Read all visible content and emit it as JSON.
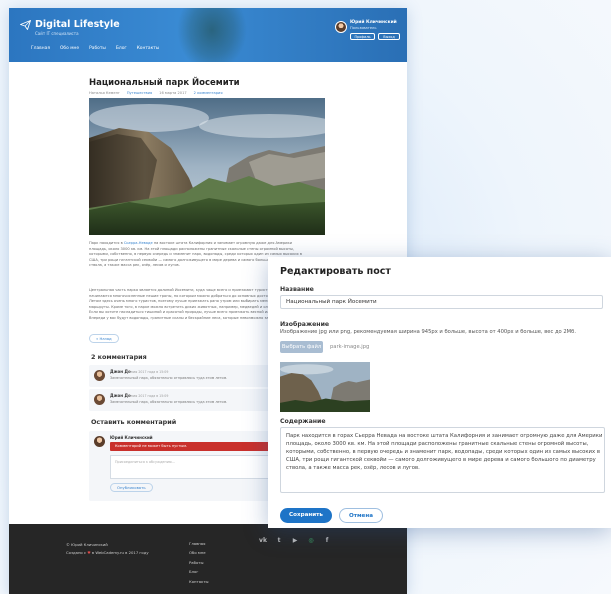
{
  "colors": {
    "header_blue": "#2c76c0",
    "accent": "#1e74c7",
    "error_red": "#c9302c",
    "footer_dark": "#262626"
  },
  "header": {
    "logo_icon": "paper-plane-icon",
    "title": "Digital Lifestyle",
    "subtitle": "Сайт IT специалиста",
    "nav": [
      "Главная",
      "Обо мне",
      "Работы",
      "Блог",
      "Контакты"
    ],
    "user_name": "Юрий Кличинский",
    "user_role": "Пользователь",
    "profile_button": "Профиль",
    "logout_button": "Выход"
  },
  "post": {
    "title": "Национальный парк Йосемити",
    "author": "Наталья Кеменг",
    "category": "Путешествия",
    "date": "16 марта 2017",
    "comments_link": "2 комментария",
    "paragraph1": [
      "Парк находится в Сьерра-Неваде на востоке штата Калифорния и занимает огромную даже для Америки",
      "площадь, около 3000 кв. км. На этой площади расположены гранитные скальные стены огромной высоты,",
      "которыми, собственно, в первую очередь и знаменит парк, водопады, среди которых один из самых высоких в",
      "США, три рощи гигантской секвойи — самого долгоживущего в мире дерева и самого большого по диаметру",
      "ствола, а также масса рек, озёр, лесов и лугов."
    ],
    "paragraph2": [
      "Центральная часть парка является долиной Йосемити, куда чаще всего и приезжают туристы. Здесь",
      "начинаются многочисленные пешие тропы, по которым можно добраться до основных достопримечательностей.",
      "Летом здесь очень много туристов, поэтому лучше приезжать рано утром или выбирать менее популярные",
      "маршруты. Кроме того, в парке можно встретить диких животных, например, медведей и оленей.",
      "Если вы хотите насладиться тишиной и красотой природы, лучше всего приезжать весной или осенью.",
      "Впереди у вас будут водопады, гранитные скалы и бескрайние леса, которые невозможно забыть."
    ],
    "link_word": "Сьерра-Неваде",
    "back_button": "« Назад"
  },
  "comments": {
    "title": "2 комментария",
    "items": [
      {
        "author": "Джон До",
        "date": "16 мая 2017 года в 15:09",
        "text": "Замечательный парк, обязательно отправлюсь туда этим летом."
      },
      {
        "author": "Джон До",
        "date": "16 мая 2017 года в 15:09",
        "text": "Замечательный парк, обязательно отправлюсь туда этим летом."
      }
    ]
  },
  "reply": {
    "title": "Оставить комментарий",
    "author": "Юрий Кличинский",
    "error": "Комментарий не может быть пустым.",
    "placeholder": "Присоединиться к обсуждению...",
    "submit": "Опубликовать"
  },
  "footer": {
    "copyright": "© Юрий Кличинский",
    "made_prefix": "Создано с",
    "made_suffix": "в WebCademy.ru в 2017 году",
    "links": [
      "Главная",
      "Обо мне",
      "Работы",
      "Блог",
      "Контакты"
    ],
    "social_icons": [
      "vk-icon",
      "twitter-icon",
      "youtube-icon",
      "instagram-icon",
      "facebook-icon"
    ]
  },
  "modal": {
    "title": "Редактировать пост",
    "name_label": "Название",
    "name_value": "Национальный парк Йосемити",
    "image_label": "Изображение",
    "image_hint": "Изображение jpg или png, рекомендуемая ширина 945px и больше, высота от 400px и больше, вес до 2Мб.",
    "file_button": "Выбрать файл",
    "file_name": "park-image.jpg",
    "content_label": "Содержание",
    "content_lines": [
      "Парк находится в горах Сьерра Невада на востоке штата Калифорния и занимает огромную даже для Америки",
      "площадь, около 3000 кв. км. На этой площади расположены гранитные скальные стены огромной высоты,",
      "которыми, собственно, в первую очередь и знаменит парк, водопады, среди которых один из самых высоких в",
      "США, три рощи гигантской секвойи — самого долгоживущего в мире дерева и самого большого по диаметру",
      "ствола, а также масса рек, озёр, лесов и лугов."
    ],
    "save_button": "Сохранить",
    "cancel_button": "Отмена"
  }
}
